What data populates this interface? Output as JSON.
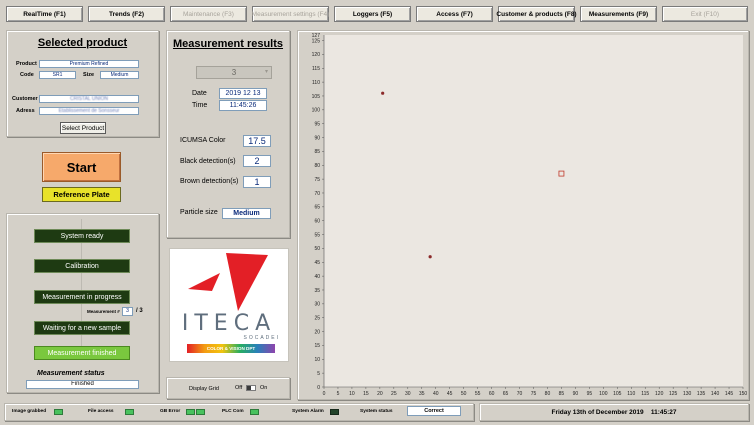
{
  "nav": {
    "tabs": [
      {
        "label": "RealTime (F1)",
        "enabled": true
      },
      {
        "label": "Trends (F2)",
        "enabled": true
      },
      {
        "label": "Maintenance (F3)",
        "enabled": false
      },
      {
        "label": "Measurement settings (F4)",
        "enabled": false
      },
      {
        "label": "Loggers (F5)",
        "enabled": true
      },
      {
        "label": "Access (F7)",
        "enabled": true
      },
      {
        "label": "Customer & products (F8)",
        "enabled": true
      },
      {
        "label": "Measurements (F9)",
        "enabled": true
      },
      {
        "label": "Exit (F10)",
        "enabled": false
      }
    ]
  },
  "selected_product": {
    "title": "Selected product",
    "product_label": "Product",
    "product_value": "Premium Refined",
    "code_label": "Code",
    "code_value": "SR1",
    "size_label": "Size",
    "size_value": "Medium",
    "customer_label": "Customer",
    "customer_value": "CRISTAL UNION",
    "adress_label": "Adress",
    "adress_value": "Établissement de Sonsseur",
    "select_button": "Select Product"
  },
  "controls": {
    "start": "Start",
    "reference_plate": "Reference Plate"
  },
  "flow": {
    "steps": [
      "System ready",
      "Calibration",
      "Measurement in progress",
      "Waiting for a new sample",
      "Measurement finished"
    ],
    "measurement_label": "Measurement #",
    "measurement_current": "3",
    "measurement_total": "/ 3",
    "status_title": "Measurement status",
    "status_value": "Finished"
  },
  "results": {
    "title": "Measurement results",
    "selector_value": "3",
    "date_label": "Date",
    "date_value": "2019 12 13",
    "time_label": "Time",
    "time_value": "11:45:26",
    "icumsa_label": "ICUMSA Color",
    "icumsa_value": "17.5",
    "black_label": "Black detection(s)",
    "black_value": "2",
    "brown_label": "Brown detection(s)",
    "brown_value": "1",
    "particle_label": "Particle size",
    "particle_value": "Medium"
  },
  "logo": {
    "brand": "ITECA",
    "sub": "SOCADEI",
    "tagline": "COLOR & VISION DPT"
  },
  "grid_toggle": {
    "label": "Display Grid",
    "off": "Off",
    "on": "On"
  },
  "chart_data": {
    "type": "scatter",
    "x_ticks": [
      "0",
      "5",
      "10",
      "15",
      "20",
      "25",
      "30",
      "35",
      "40",
      "45",
      "50",
      "55",
      "60",
      "65",
      "70",
      "75",
      "80",
      "85",
      "90",
      "95",
      "100",
      "105",
      "110",
      "115",
      "120",
      "125",
      "130",
      "135",
      "140",
      "145",
      "150"
    ],
    "y_ticks": [
      "0",
      "5",
      "10",
      "15",
      "20",
      "25",
      "30",
      "35",
      "40",
      "45",
      "50",
      "55",
      "60",
      "65",
      "70",
      "75",
      "80",
      "85",
      "90",
      "95",
      "100",
      "105",
      "110",
      "115",
      "120",
      "125"
    ],
    "xlim": [
      0,
      150
    ],
    "ylim": [
      0,
      127
    ],
    "series": [
      {
        "type": "black",
        "color": "#8b2a2a",
        "points": [
          [
            21,
            106
          ],
          [
            38,
            47
          ]
        ]
      },
      {
        "type": "brown",
        "color": "#c0392b",
        "points": [
          [
            85,
            77
          ]
        ]
      }
    ],
    "y_top_label": "127"
  },
  "statusbar": {
    "image_grabbed": "Image grabbed",
    "file_access": "File access",
    "gb_error": "GB Error",
    "plc_com": "PLC Com",
    "system_alarm": "System Alarm",
    "system_status_label": "System status",
    "system_status_value": "Correct",
    "datetime": "Friday 13th of December 2019    11:45:27"
  }
}
